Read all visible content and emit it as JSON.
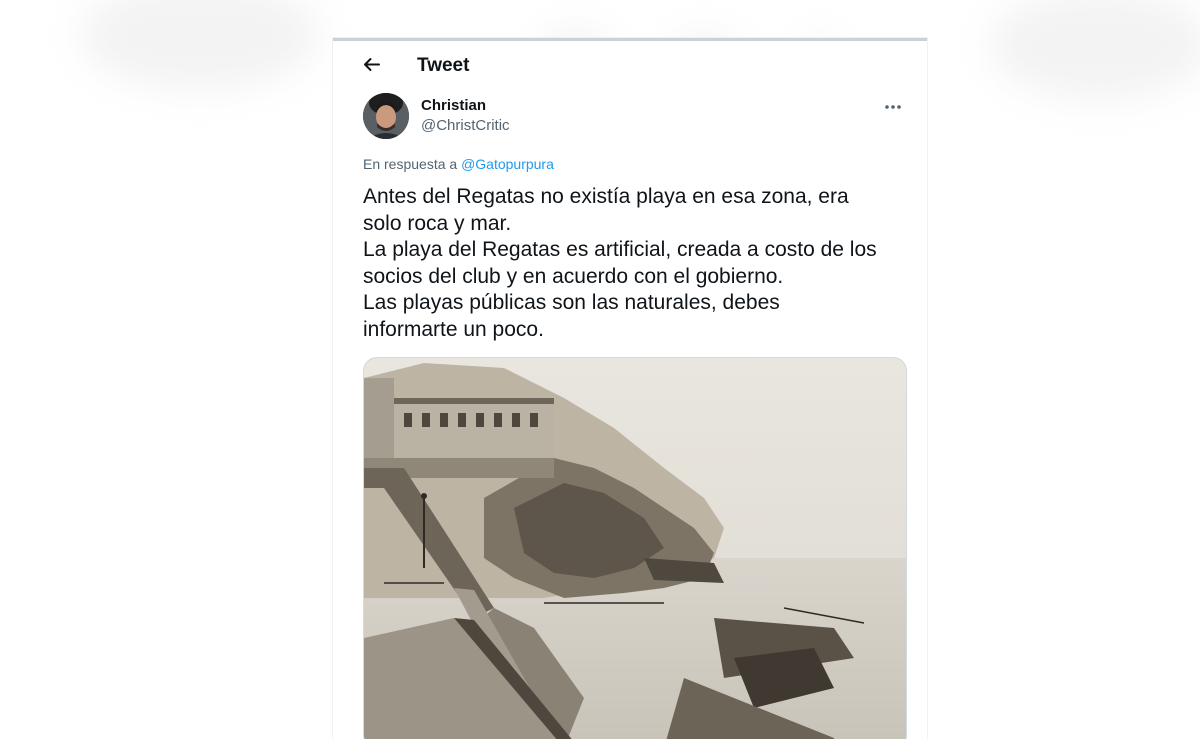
{
  "header": {
    "back_icon": "arrow-left-icon",
    "title": "Tweet"
  },
  "tweet": {
    "author": {
      "name": "Christian",
      "handle": "@ChristCritic",
      "avatar_icon": "avatar-photo"
    },
    "more_icon": "more-horizontal-icon",
    "reply_prefix": "En respuesta a",
    "reply_to": "@Gatopurpura",
    "text": "Antes del Regatas no existía playa en esa zona, era\nsolo roca y mar.\nLa playa del Regatas es artificial, creada a costo de los\nsocios del club y en acuerdo con el gobierno.\nLas playas públicas son las naturales, debes\ninformarte un poco.",
    "media": {
      "kind": "sepia-photo"
    }
  },
  "colors": {
    "text_primary": "#0f1419",
    "text_secondary": "#536471",
    "link": "#1d9bf0",
    "border": "#cfd9de"
  }
}
